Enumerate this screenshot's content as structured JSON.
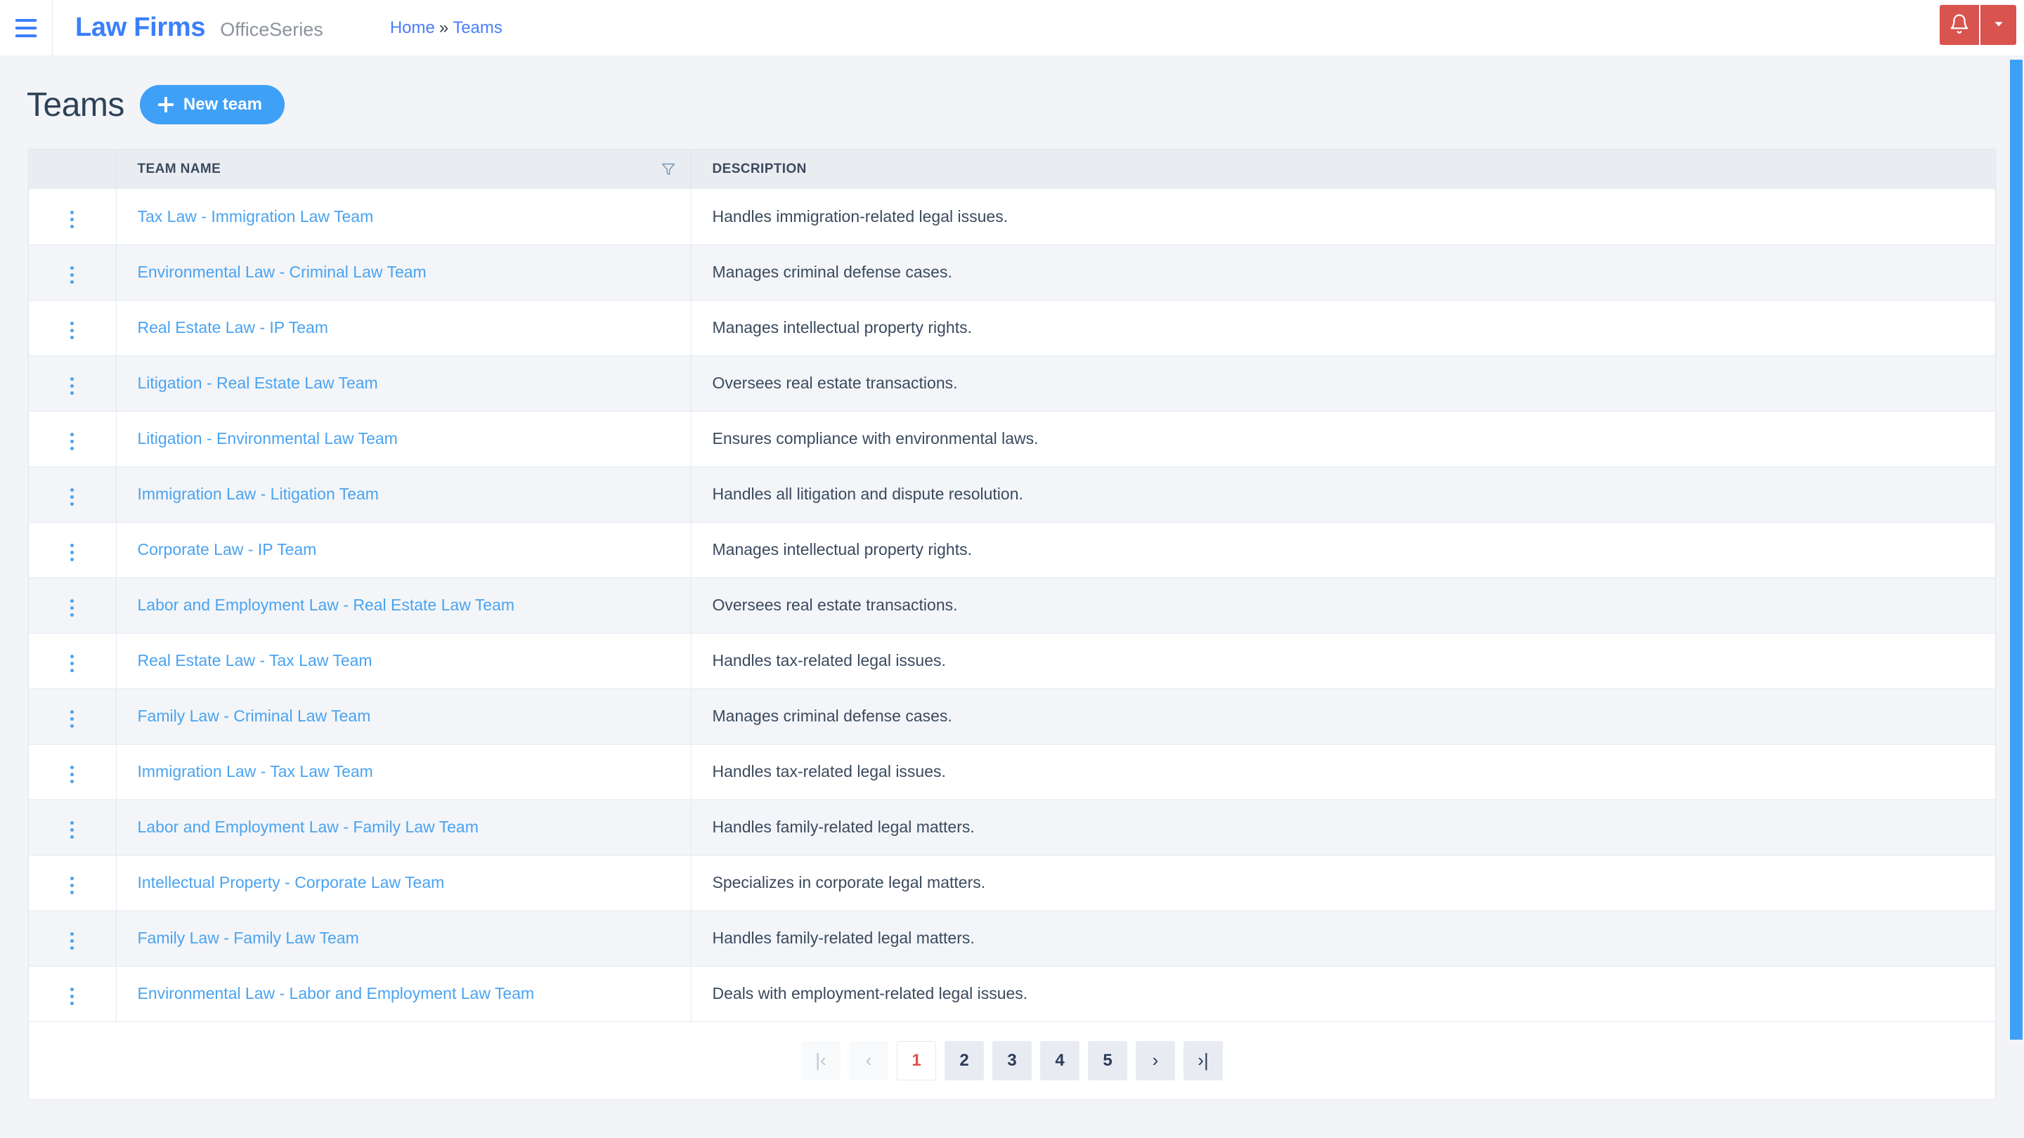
{
  "topbar": {
    "menu_icon": "hamburger-icon",
    "brand_main": "Law Firms",
    "brand_sub": "OfficeSeries",
    "breadcrumb": {
      "home": "Home",
      "separator": "»",
      "current": "Teams"
    },
    "notification_icon": "bell-icon",
    "caret_icon": "chevron-down-icon",
    "accent_red": "#d9534f",
    "accent_blue": "#3b7ffb"
  },
  "page": {
    "title": "Teams",
    "new_button_label": "New team",
    "new_button_color": "#3fa0f7"
  },
  "table": {
    "columns": [
      {
        "key": "menu",
        "label": ""
      },
      {
        "key": "name",
        "label": "TEAM NAME",
        "filter_icon": "filter-funnel-icon"
      },
      {
        "key": "description",
        "label": "DESCRIPTION"
      }
    ],
    "rows": [
      {
        "name": "Tax Law - Immigration Law Team",
        "description": "Handles immigration-related legal issues."
      },
      {
        "name": "Environmental Law - Criminal Law Team",
        "description": "Manages criminal defense cases."
      },
      {
        "name": "Real Estate Law - IP Team",
        "description": "Manages intellectual property rights."
      },
      {
        "name": "Litigation - Real Estate Law Team",
        "description": "Oversees real estate transactions."
      },
      {
        "name": "Litigation - Environmental Law Team",
        "description": "Ensures compliance with environmental laws."
      },
      {
        "name": "Immigration Law - Litigation Team",
        "description": "Handles all litigation and dispute resolution."
      },
      {
        "name": "Corporate Law - IP Team",
        "description": "Manages intellectual property rights."
      },
      {
        "name": "Labor and Employment Law - Real Estate Law Team",
        "description": "Oversees real estate transactions."
      },
      {
        "name": "Real Estate Law - Tax Law Team",
        "description": "Handles tax-related legal issues."
      },
      {
        "name": "Family Law - Criminal Law Team",
        "description": "Manages criminal defense cases."
      },
      {
        "name": "Immigration Law - Tax Law Team",
        "description": "Handles tax-related legal issues."
      },
      {
        "name": "Labor and Employment Law - Family Law Team",
        "description": "Handles family-related legal matters."
      },
      {
        "name": "Intellectual Property - Corporate Law Team",
        "description": "Specializes in corporate legal matters."
      },
      {
        "name": "Family Law - Family Law Team",
        "description": "Handles family-related legal matters."
      },
      {
        "name": "Environmental Law - Labor and Employment Law Team",
        "description": "Deals with employment-related legal issues."
      }
    ],
    "row_menu_icon": "kebab-menu-icon"
  },
  "pagination": {
    "first_label": "|‹",
    "prev_label": "‹",
    "next_label": "›",
    "last_label": "›|",
    "pages": [
      "1",
      "2",
      "3",
      "4",
      "5"
    ],
    "active_page": "1",
    "active_color": "#d9534f",
    "first_disabled": true,
    "prev_disabled": true
  },
  "scrollbar": {
    "color": "#3fa0f7"
  }
}
